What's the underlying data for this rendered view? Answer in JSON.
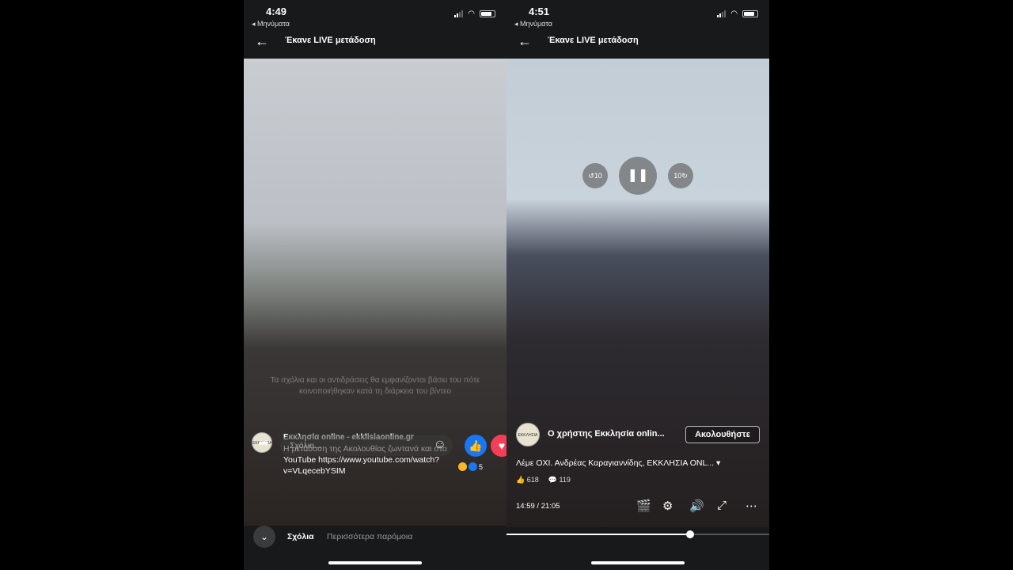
{
  "left": {
    "status": {
      "time": "4:49",
      "back_app": "◂ Μηνύματα"
    },
    "header": {
      "title": "Έκανε LIVE μετάδοση"
    },
    "overlay_text": "Τα σχόλια και οι αντιδράσεις θα εμφανίζονται βάσει του πότε κοινοποιήθηκαν κατά τη διάρκεια του βίντεο",
    "post": {
      "author": "Εκκλησία online - ekklisiaonline.gr",
      "text": "Η μετάδοση της Ακολουθίας ζωντανά και στο YouTube https://www.youtube.com/watch?v=VLqecebYSIM",
      "reaction_count": "5"
    },
    "comment": {
      "placeholder": "Σχόλιο..."
    },
    "tabs": {
      "active": "Σχόλια",
      "more": "Περισσότερα παρόμοια"
    }
  },
  "right": {
    "status": {
      "time": "4:51",
      "back_app": "◂ Μηνύματα"
    },
    "header": {
      "title": "Έκανε LIVE μετάδοση"
    },
    "post": {
      "author": "Ο χρήστης Εκκλησία onlin...",
      "follow": "Ακολουθήστε",
      "description": "Λέμε ΟΧΙ. Ανδρέας Καραγιαννίδης, ΕΚΚΛΗΣΙΑ ONL...",
      "likes": "618",
      "comments": "119"
    },
    "player": {
      "time": "14:59 / 21:05",
      "progress": 0.7
    }
  },
  "icons": [
    "back-arrow-icon",
    "share-icon",
    "emoji-icon",
    "like-icon",
    "love-icon",
    "chevron-down-icon",
    "pause-icon",
    "rewind-10-icon",
    "forward-10-icon",
    "clapperboard-icon",
    "settings-icon",
    "volume-icon",
    "fullscreen-icon",
    "more-icon"
  ],
  "colors": {
    "like": "#1877f2",
    "love": "#f33e58",
    "background": "#18191a"
  }
}
